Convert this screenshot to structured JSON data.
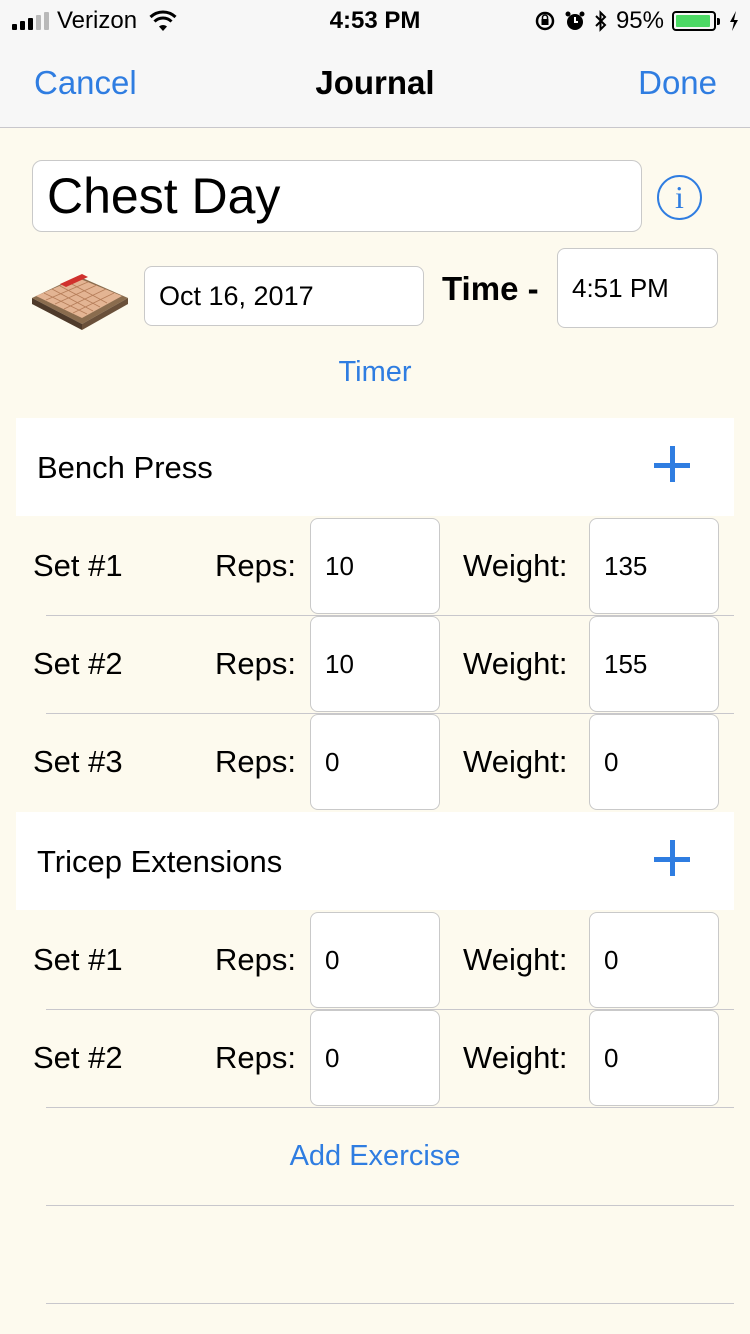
{
  "status_bar": {
    "carrier": "Verizon",
    "time": "4:53 PM",
    "battery": "95%",
    "battery_level": 0.95
  },
  "nav": {
    "cancel": "Cancel",
    "title": "Journal",
    "done": "Done"
  },
  "workout": {
    "title": "Chest Day",
    "date": "Oct 16, 2017",
    "time_label": "Time -",
    "time": "4:51 PM",
    "timer": "Timer"
  },
  "labels": {
    "reps": "Reps:",
    "weight": "Weight:"
  },
  "exercises": [
    {
      "name": "Bench Press",
      "sets": [
        {
          "label": "Set #1",
          "reps": "10",
          "weight": "135"
        },
        {
          "label": "Set #2",
          "reps": "10",
          "weight": "155"
        },
        {
          "label": "Set #3",
          "reps": "0",
          "weight": "0"
        }
      ]
    },
    {
      "name": "Tricep Extensions",
      "sets": [
        {
          "label": "Set #1",
          "reps": "0",
          "weight": "0"
        },
        {
          "label": "Set #2",
          "reps": "0",
          "weight": "0"
        }
      ]
    }
  ],
  "add_exercise": "Add Exercise",
  "colors": {
    "accent": "#2f7de1",
    "background": "#fdfaee",
    "battery": "#4cd964"
  },
  "icons": [
    "signal-icon",
    "wifi-icon",
    "rotation-lock-icon",
    "alarm-icon",
    "bluetooth-icon",
    "battery-icon",
    "charging-icon",
    "info-icon",
    "calendar-icon",
    "plus-icon"
  ]
}
